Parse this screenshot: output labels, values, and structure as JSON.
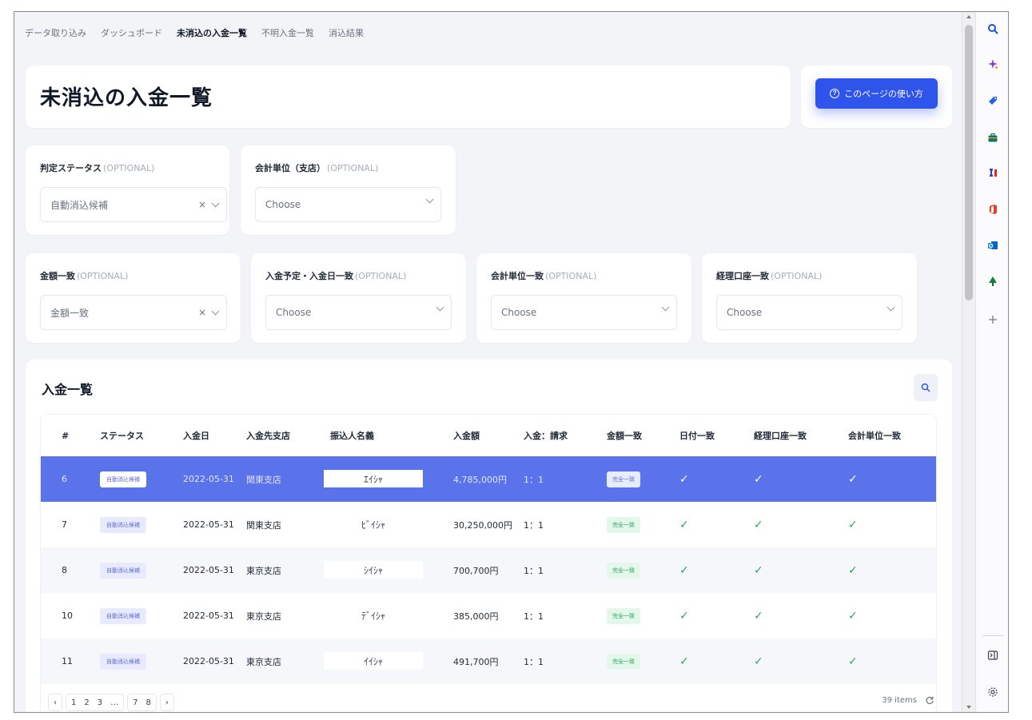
{
  "nav": {
    "items": [
      {
        "label": "データ取り込み",
        "active": false
      },
      {
        "label": "ダッシュボード",
        "active": false
      },
      {
        "label": "未消込の入金一覧",
        "active": true
      },
      {
        "label": "不明入金一覧",
        "active": false
      },
      {
        "label": "消込結果",
        "active": false
      }
    ]
  },
  "header": {
    "title": "未消込の入金一覧",
    "help_label": "このページの使い方"
  },
  "filters": {
    "optional_tag": "(OPTIONAL)",
    "status": {
      "label": "判定ステータス",
      "value": "自動消込候補",
      "clear": "×"
    },
    "unit": {
      "label": "会計単位（支店）",
      "value": "Choose"
    },
    "amount_match": {
      "label": "金額一致",
      "value": "金額一致",
      "clear": "×"
    },
    "date_match": {
      "label": "入金予定・入金日一致",
      "value": "Choose"
    },
    "unit_match": {
      "label": "会計単位一致",
      "value": "Choose"
    },
    "account_match": {
      "label": "経理口座一致",
      "value": "Choose"
    }
  },
  "list": {
    "title": "入金一覧",
    "columns": [
      "#",
      "ステータス",
      "入金日",
      "入金先支店",
      "振込人名義",
      "入金額",
      "入金：請求",
      "金額一致",
      "日付一致",
      "経理口座一致",
      "会計単位一致"
    ],
    "rows": [
      {
        "id": "6",
        "status": "自動消込候補",
        "date": "2022-05-31",
        "branch": "関東支店",
        "payer": "ｴｲｼｬ",
        "amount": "4,785,000円",
        "ratio": "1：1",
        "amount_match": "完全一致",
        "date_ok": "✓",
        "account_ok": "✓",
        "unit_ok": "✓",
        "selected": true
      },
      {
        "id": "7",
        "status": "自動消込候補",
        "date": "2022-05-31",
        "branch": "関東支店",
        "payer": "ﾋﾞｲｼｬ",
        "amount": "30,250,000円",
        "ratio": "1：1",
        "amount_match": "完全一致",
        "date_ok": "✓",
        "account_ok": "✓",
        "unit_ok": "✓",
        "selected": false
      },
      {
        "id": "8",
        "status": "自動消込候補",
        "date": "2022-05-31",
        "branch": "東京支店",
        "payer": "ｼｲｼｬ",
        "amount": "700,700円",
        "ratio": "1：1",
        "amount_match": "完全一致",
        "date_ok": "✓",
        "account_ok": "✓",
        "unit_ok": "✓",
        "selected": false
      },
      {
        "id": "10",
        "status": "自動消込候補",
        "date": "2022-05-31",
        "branch": "東京支店",
        "payer": "ﾃﾞｲｼｬ",
        "amount": "385,000円",
        "ratio": "1：1",
        "amount_match": "完全一致",
        "date_ok": "✓",
        "account_ok": "✓",
        "unit_ok": "✓",
        "selected": false
      },
      {
        "id": "11",
        "status": "自動消込候補",
        "date": "2022-05-31",
        "branch": "東京支店",
        "payer": "ｲｲｼｬ",
        "amount": "491,700円",
        "ratio": "1：1",
        "amount_match": "完全一致",
        "date_ok": "✓",
        "account_ok": "✓",
        "unit_ok": "✓",
        "selected": false
      }
    ]
  },
  "pager": {
    "prev": "‹",
    "next": "›",
    "pages": [
      "1",
      "2",
      "3",
      "…",
      "7",
      "8"
    ],
    "total": "39 items"
  },
  "colors": {
    "accent": "#2f54eb",
    "selected_row": "#5b73ea",
    "success": "#2ea55a"
  }
}
